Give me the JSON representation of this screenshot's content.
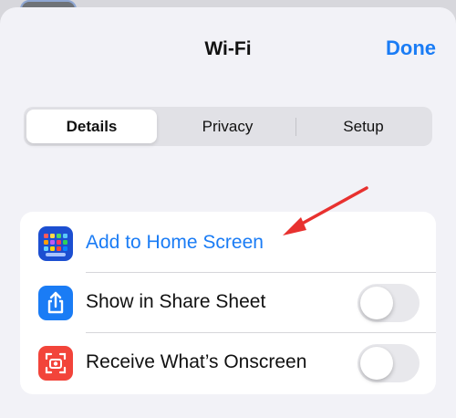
{
  "header": {
    "title": "Wi-Fi",
    "done_label": "Done"
  },
  "tabs": [
    {
      "label": "Details",
      "active": true
    },
    {
      "label": "Privacy",
      "active": false
    },
    {
      "label": "Setup",
      "active": false
    }
  ],
  "list": {
    "items": [
      {
        "label": "Add to Home Screen",
        "icon": "home-screen-grid-icon",
        "icon_color": "#1c4fd1"
      },
      {
        "label": "Show in Share Sheet",
        "icon": "share-icon",
        "icon_color": "#1a7cf5",
        "toggle_on": false
      },
      {
        "label": "Receive What’s Onscreen",
        "icon": "screen-capture-icon",
        "icon_color": "#f2443a",
        "toggle_on": false
      }
    ]
  },
  "colors": {
    "accent": "#1a7cf5",
    "annotation_arrow": "#e8312f"
  }
}
